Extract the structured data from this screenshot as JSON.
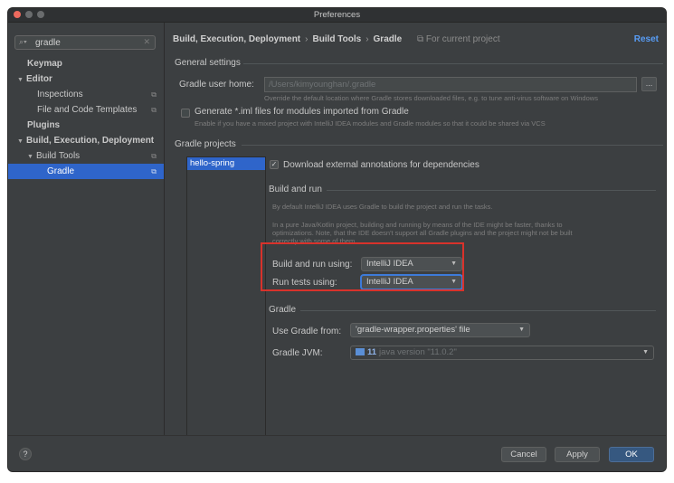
{
  "window": {
    "title": "Preferences"
  },
  "sidebar": {
    "search": {
      "value": "gradle",
      "icon": "search-icon"
    },
    "items": [
      {
        "label": "Keymap"
      },
      {
        "label": "Editor"
      },
      {
        "label": "Inspections"
      },
      {
        "label": "File and Code Templates"
      },
      {
        "label": "Plugins"
      },
      {
        "label": "Build, Execution, Deployment"
      },
      {
        "label": "Build Tools"
      },
      {
        "label": "Gradle"
      }
    ]
  },
  "header": {
    "breadcrumb": [
      "Build, Execution, Deployment",
      "Build Tools",
      "Gradle"
    ],
    "project_scope": "For current project",
    "reset_label": "Reset"
  },
  "general": {
    "section_title": "General settings",
    "user_home_label": "Gradle user home:",
    "user_home_value": "/Users/kimyounghan/.gradle",
    "user_home_hint": "Override the default location where Gradle stores downloaded files, e.g. to tune anti-virus software on Windows",
    "browse_label": "...",
    "generate_iml_label": "Generate *.iml files for modules imported from Gradle",
    "generate_iml_hint": "Enable if you have a mixed project with IntelliJ IDEA modules and Gradle modules so that it could be shared via VCS"
  },
  "projects": {
    "section_title": "Gradle projects",
    "items": [
      "hello-spring"
    ],
    "download_annotations_label": "Download external annotations for dependencies",
    "download_annotations_checked": true
  },
  "build_run": {
    "section_title": "Build and run",
    "desc1": "By default IntelliJ IDEA uses Gradle to build the project and run the tasks.",
    "desc2_lines": [
      "In a pure Java/Kotlin project, building and running by means of the IDE might be faster, thanks to",
      "optimizations. Note, that the IDE doesn't support all Gradle plugins and the project might not be built",
      "correctly with some of them."
    ],
    "build_run_label": "Build and run using:",
    "build_run_value": "IntelliJ IDEA",
    "run_tests_label": "Run tests using:",
    "run_tests_value": "IntelliJ IDEA"
  },
  "gradle": {
    "section_title": "Gradle",
    "use_from_label": "Use Gradle from:",
    "use_from_value": "'gradle-wrapper.properties' file",
    "jvm_label": "Gradle JVM:",
    "jvm_version": "11",
    "jvm_detail": "java version \"11.0.2\""
  },
  "footer": {
    "help_label": "?",
    "cancel_label": "Cancel",
    "apply_label": "Apply",
    "ok_label": "OK"
  },
  "colors": {
    "accent": "#2f65ca",
    "highlight_box": "#d9322b",
    "reset_link": "#589df6"
  }
}
